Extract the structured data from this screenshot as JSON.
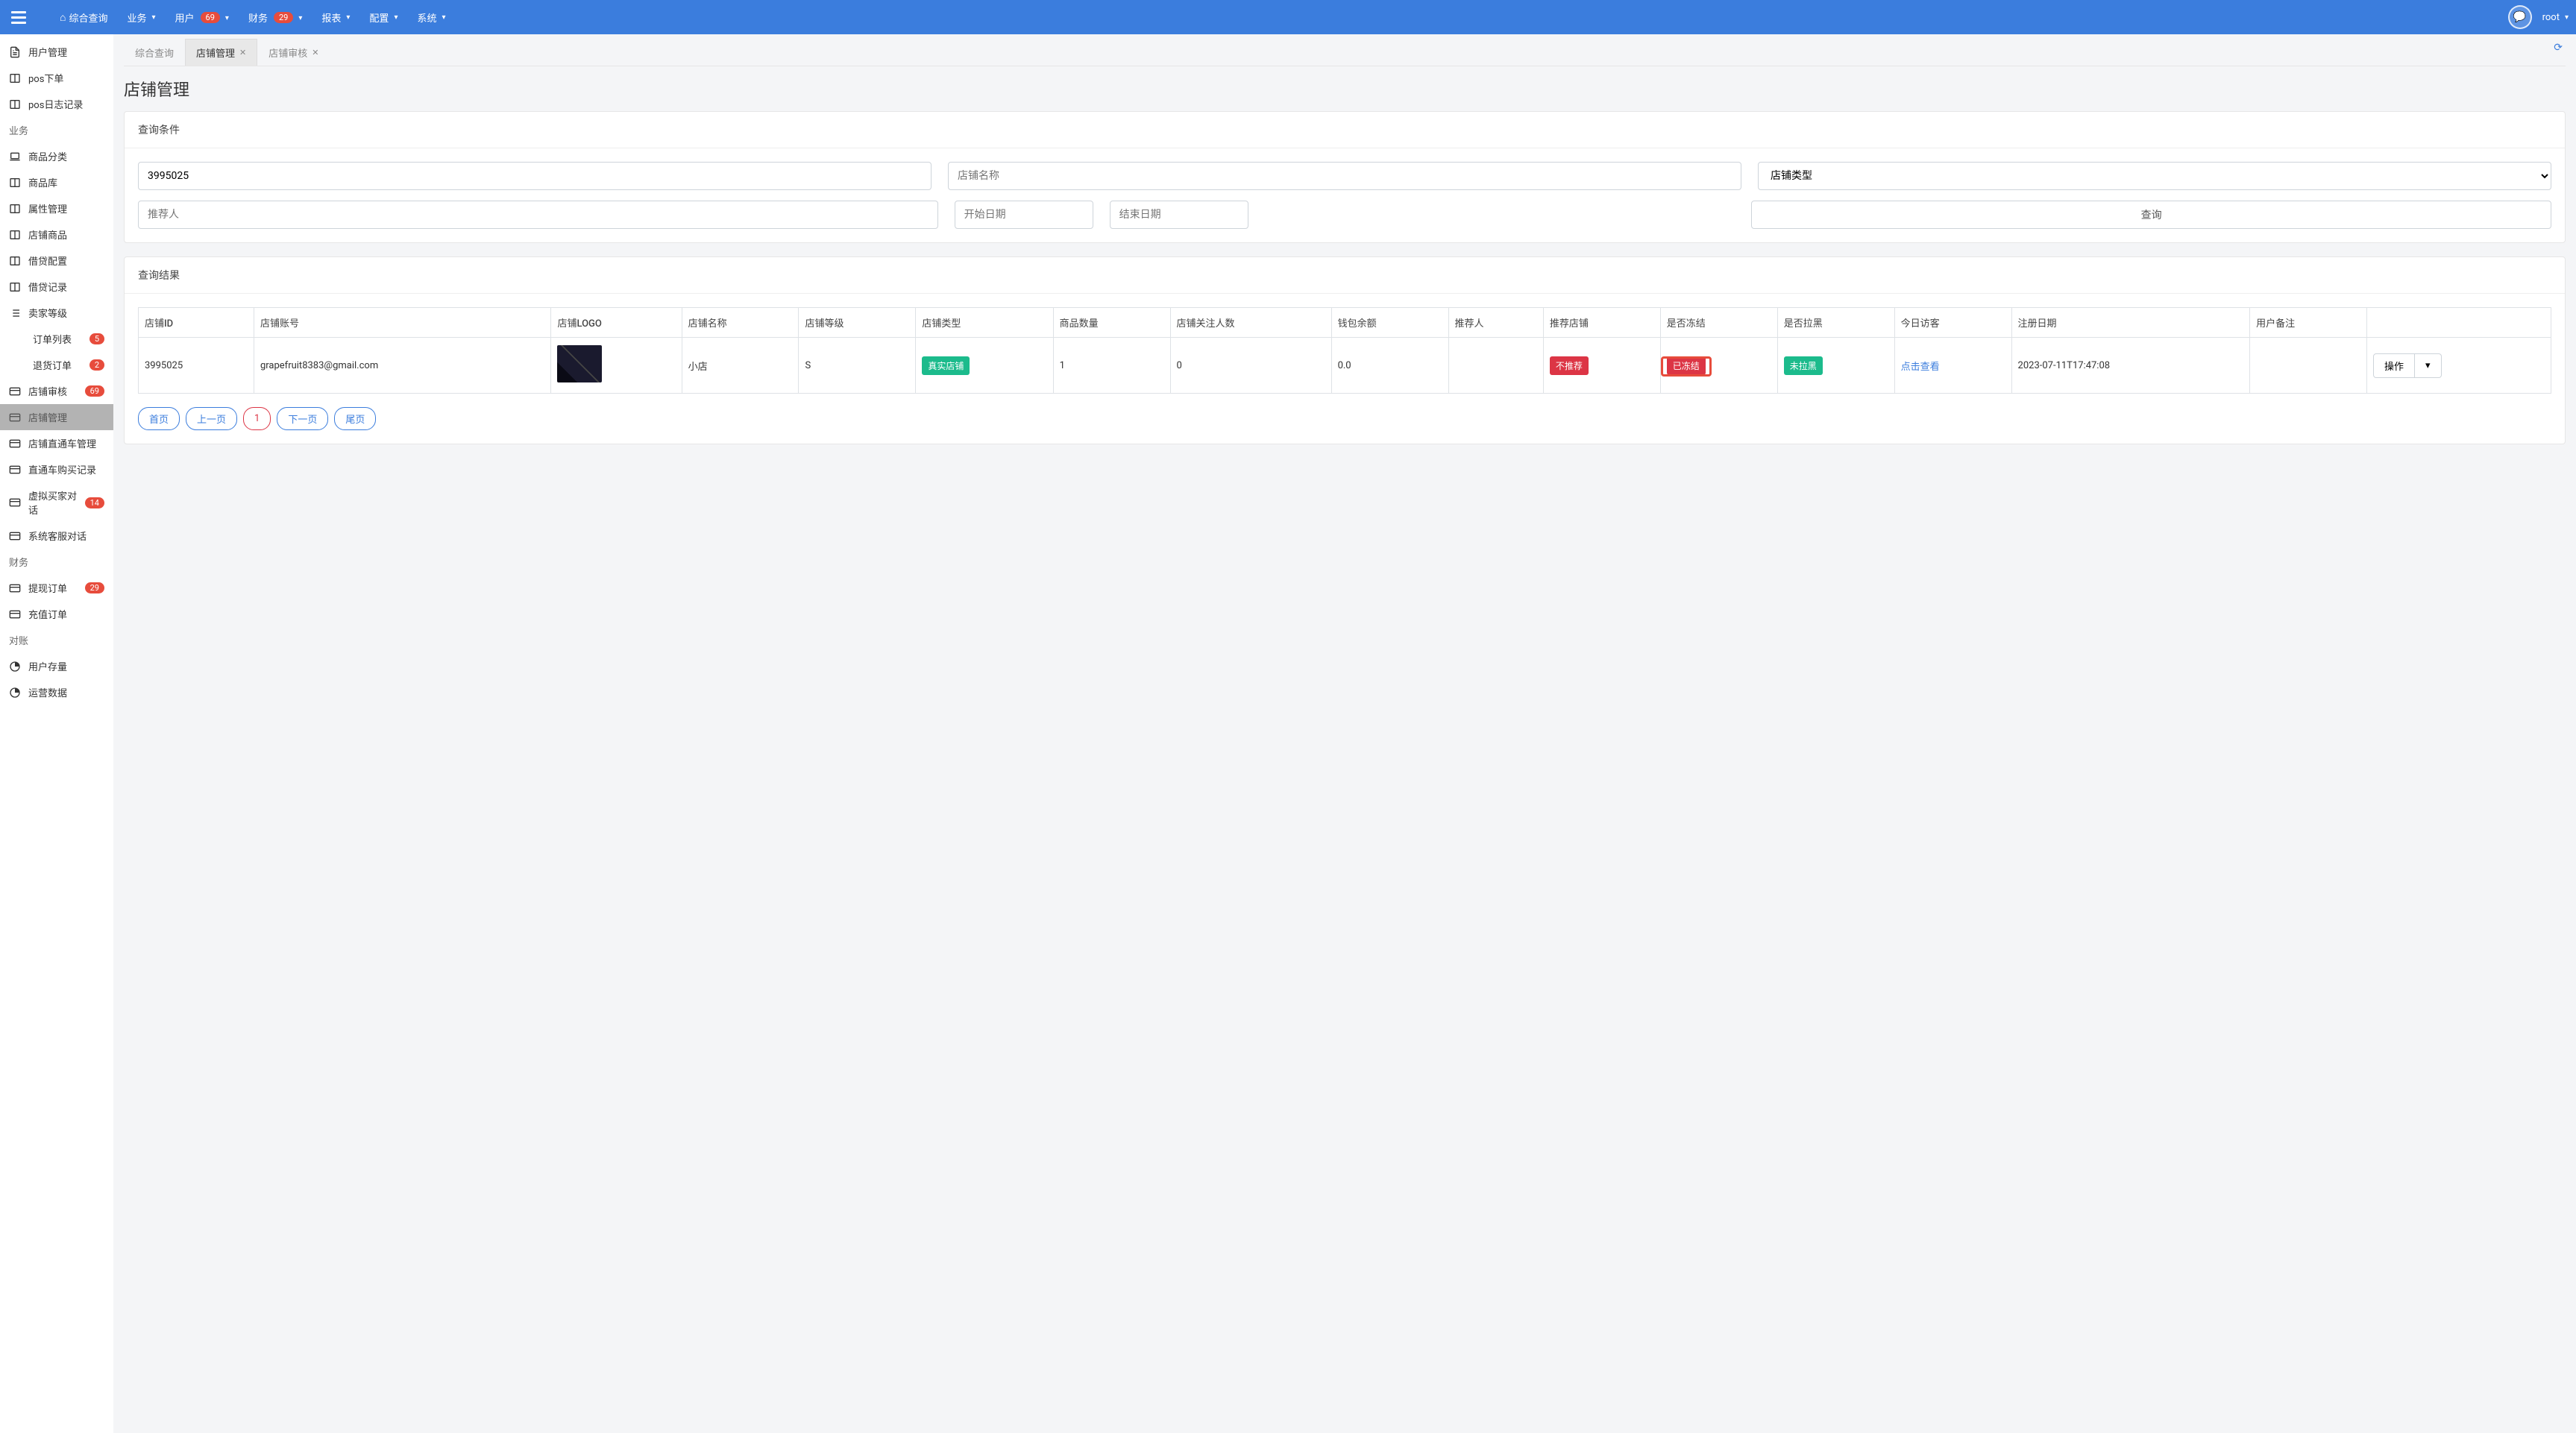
{
  "topnav": {
    "home": "综合查询",
    "items": [
      {
        "label": "业务"
      },
      {
        "label": "用户",
        "badge": "69"
      },
      {
        "label": "财务",
        "badge": "29"
      },
      {
        "label": "报表"
      },
      {
        "label": "配置"
      },
      {
        "label": "系统"
      }
    ],
    "user": "root"
  },
  "sidebar": {
    "items": [
      {
        "icon": "doc",
        "label": "用户管理"
      },
      {
        "icon": "book",
        "label": "pos下单"
      },
      {
        "icon": "book",
        "label": "pos日志记录"
      }
    ],
    "section1_label": "业务",
    "section1": [
      {
        "icon": "laptop",
        "label": "商品分类"
      },
      {
        "icon": "book",
        "label": "商品库"
      },
      {
        "icon": "book",
        "label": "属性管理"
      },
      {
        "icon": "book",
        "label": "店铺商品"
      },
      {
        "icon": "book",
        "label": "借贷配置"
      },
      {
        "icon": "book",
        "label": "借贷记录"
      },
      {
        "icon": "list",
        "label": "卖家等级"
      }
    ],
    "subitems": [
      {
        "label": "订单列表",
        "badge": "5"
      },
      {
        "label": "退货订单",
        "badge": "2"
      }
    ],
    "section2": [
      {
        "icon": "card",
        "label": "店铺审核",
        "badge": "69"
      },
      {
        "icon": "card",
        "label": "店铺管理",
        "active": true
      },
      {
        "icon": "card",
        "label": "店铺直通车管理"
      },
      {
        "icon": "card",
        "label": "直通车购买记录"
      },
      {
        "icon": "card",
        "label": "虚拟买家对话",
        "badge": "14"
      },
      {
        "icon": "card",
        "label": "系统客服对话"
      }
    ],
    "section3_label": "财务",
    "section3": [
      {
        "icon": "card",
        "label": "提现订单",
        "badge": "29"
      },
      {
        "icon": "card",
        "label": "充值订单"
      }
    ],
    "section4_label": "对账",
    "section4": [
      {
        "icon": "pie",
        "label": "用户存量"
      },
      {
        "icon": "pie",
        "label": "运营数据"
      }
    ]
  },
  "tabs": [
    "综合查询",
    "店铺管理",
    "店铺审核"
  ],
  "active_tab": 1,
  "page_title": "店铺管理",
  "query": {
    "card_title": "查询条件",
    "id_value": "3995025",
    "name_ph": "店铺名称",
    "type_ph": "店铺类型",
    "referrer_ph": "推荐人",
    "start_ph": "开始日期",
    "end_ph": "结束日期",
    "btn": "查询"
  },
  "results": {
    "card_title": "查询结果",
    "headers": [
      "店铺ID",
      "店铺账号",
      "店铺LOGO",
      "店铺名称",
      "店铺等级",
      "店铺类型",
      "商品数量",
      "店铺关注人数",
      "钱包余额",
      "推荐人",
      "推荐店铺",
      "是否冻结",
      "是否拉黑",
      "今日访客",
      "注册日期",
      "用户备注",
      ""
    ],
    "row": {
      "id": "3995025",
      "account": "grapefruit8383@gmail.com",
      "name": "小店",
      "level": "S",
      "type_tag": "真实店铺",
      "goods": "1",
      "followers": "0",
      "balance": "0.0",
      "referrer": "",
      "recommend_tag": "不推荐",
      "frozen_tag": "已冻结",
      "blacklist_tag": "未拉黑",
      "visitors": "点击查看",
      "regdate": "2023-07-11T17:47:08",
      "remark": "",
      "op": "操作"
    }
  },
  "pagination": [
    "首页",
    "上一页",
    "1",
    "下一页",
    "尾页"
  ]
}
